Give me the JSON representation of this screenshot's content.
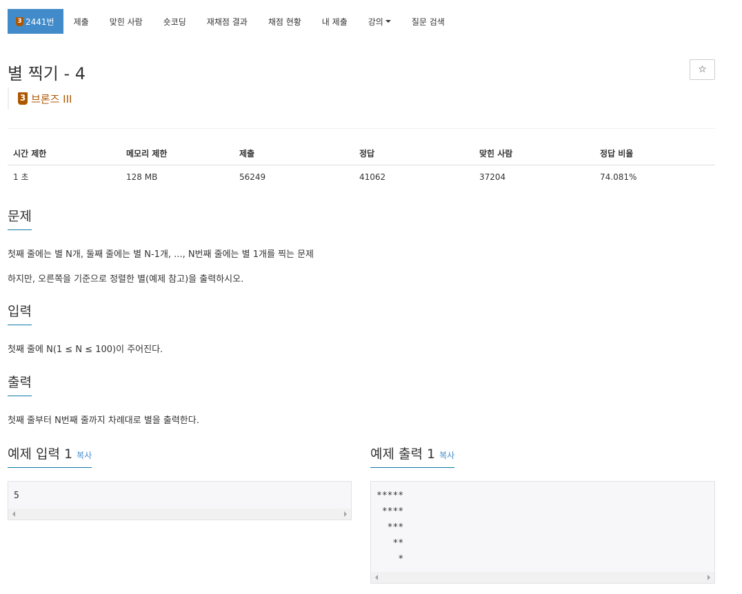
{
  "nav": {
    "problem_badge": "3",
    "problem_id": "2441번",
    "items": [
      "제출",
      "맞힌 사람",
      "숏코딩",
      "재채점 결과",
      "채점 현황",
      "내 제출",
      "강의",
      "질문 검색"
    ]
  },
  "problem": {
    "title": "별 찍기 - 4",
    "star_icon": "☆",
    "tier_badge": "3",
    "tier": "브론즈 III"
  },
  "info": {
    "headers": [
      "시간 제한",
      "메모리 제한",
      "제출",
      "정답",
      "맞힌 사람",
      "정답 비율"
    ],
    "values": [
      "1 초",
      "128 MB",
      "56249",
      "41062",
      "37204",
      "74.081%"
    ]
  },
  "sections": {
    "problem_title": "문제",
    "problem_lines": [
      "첫째 줄에는 별 N개, 둘째 줄에는 별 N-1개, ..., N번째 줄에는 별 1개를 찍는 문제",
      "하지만, 오른쪽을 기준으로 정렬한 별(예제 참고)을 출력하시오."
    ],
    "input_title": "입력",
    "input_text": "첫째 줄에 N(1 ≤ N ≤ 100)이 주어진다.",
    "output_title": "출력",
    "output_text": "첫째 줄부터 N번째 줄까지 차례대로 별을 출력한다."
  },
  "samples": {
    "input_title": "예제 입력 1",
    "output_title": "예제 출력 1",
    "copy_label": "복사",
    "input_text": "5",
    "output_text": "*****\n ****\n  ***\n   **\n    *"
  },
  "colors": {
    "accent": "#428bca",
    "bronze": "#ad5600"
  }
}
